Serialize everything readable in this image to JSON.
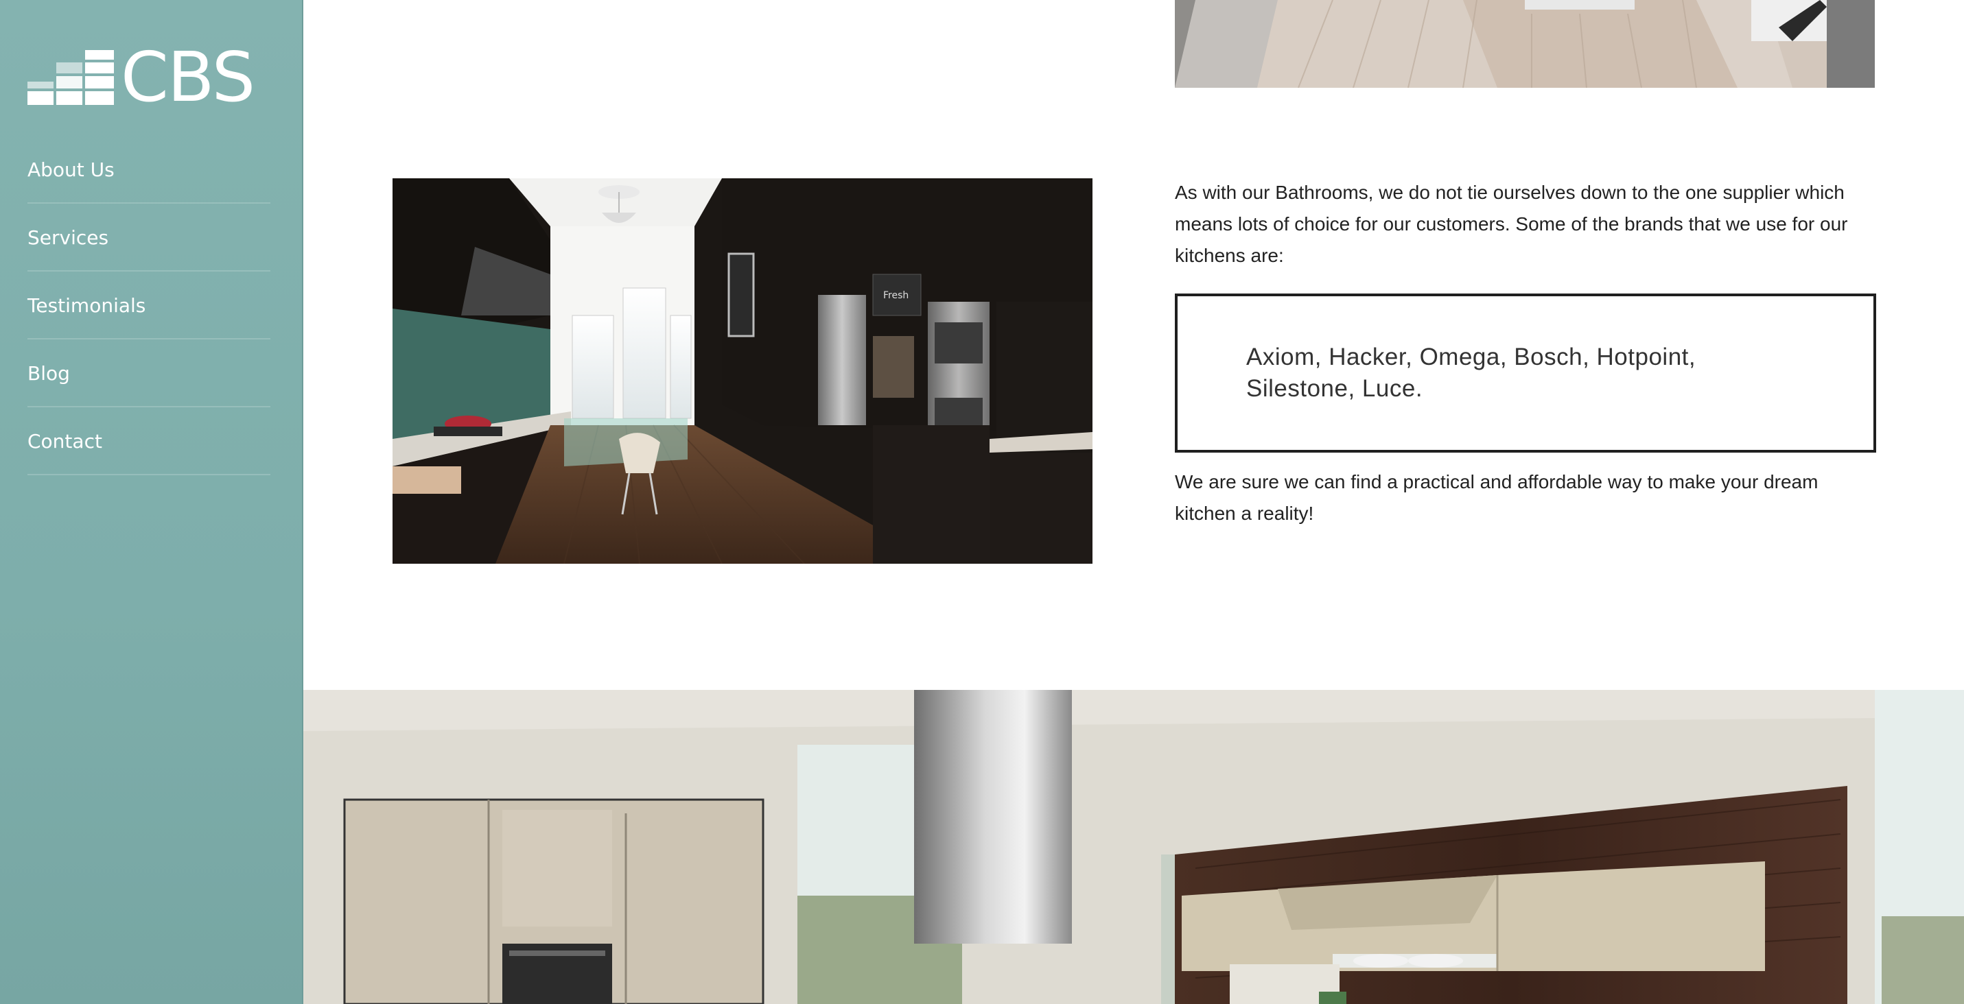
{
  "brand": {
    "name": "CBS",
    "colors": {
      "sidebar": "#82b1ae",
      "text": "#222222"
    }
  },
  "nav": {
    "items": [
      {
        "label": "About Us"
      },
      {
        "label": "Services"
      },
      {
        "label": "Testimonials"
      },
      {
        "label": "Blog"
      },
      {
        "label": "Contact"
      }
    ]
  },
  "content": {
    "intro": "As with our Bathrooms, we do not tie ourselves down to the one supplier which means lots of choice for our customers. Some of the brands that we use for our kitchens are:",
    "brands_list": "Axiom, Hacker, Omega, Bosch, Hotpoint, Silestone, Luce.",
    "closing": "We are sure we can find a practical and affordable way to make your dream kitchen a reality!"
  },
  "images": {
    "top": "kitchen-floor-photo",
    "middle": "dark-kitchen-photo",
    "bottom": "modern-kitchen-photo"
  }
}
